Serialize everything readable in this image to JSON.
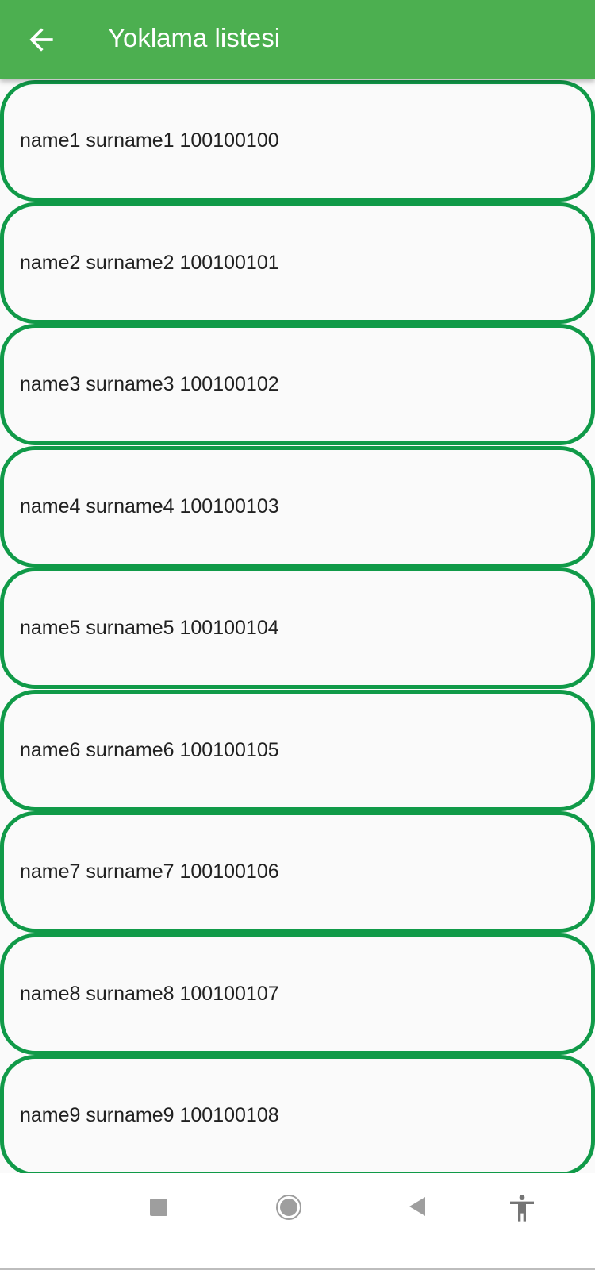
{
  "appbar": {
    "title": "Yoklama listesi",
    "back_icon": "arrow-left-icon"
  },
  "colors": {
    "appbar": "#4caf50",
    "card_border": "#109a48"
  },
  "students": [
    {
      "label": "name1 surname1 100100100"
    },
    {
      "label": "name2 surname2 100100101"
    },
    {
      "label": "name3 surname3 100100102"
    },
    {
      "label": "name4 surname4 100100103"
    },
    {
      "label": "name5 surname5 100100104"
    },
    {
      "label": "name6 surname6 100100105"
    },
    {
      "label": "name7 surname7 100100106"
    },
    {
      "label": "name8 surname8 100100107"
    },
    {
      "label": "name9 surname9 100100108"
    }
  ],
  "navbar": {
    "icons": [
      "recents-icon",
      "home-icon",
      "back-icon",
      "accessibility-icon"
    ]
  }
}
